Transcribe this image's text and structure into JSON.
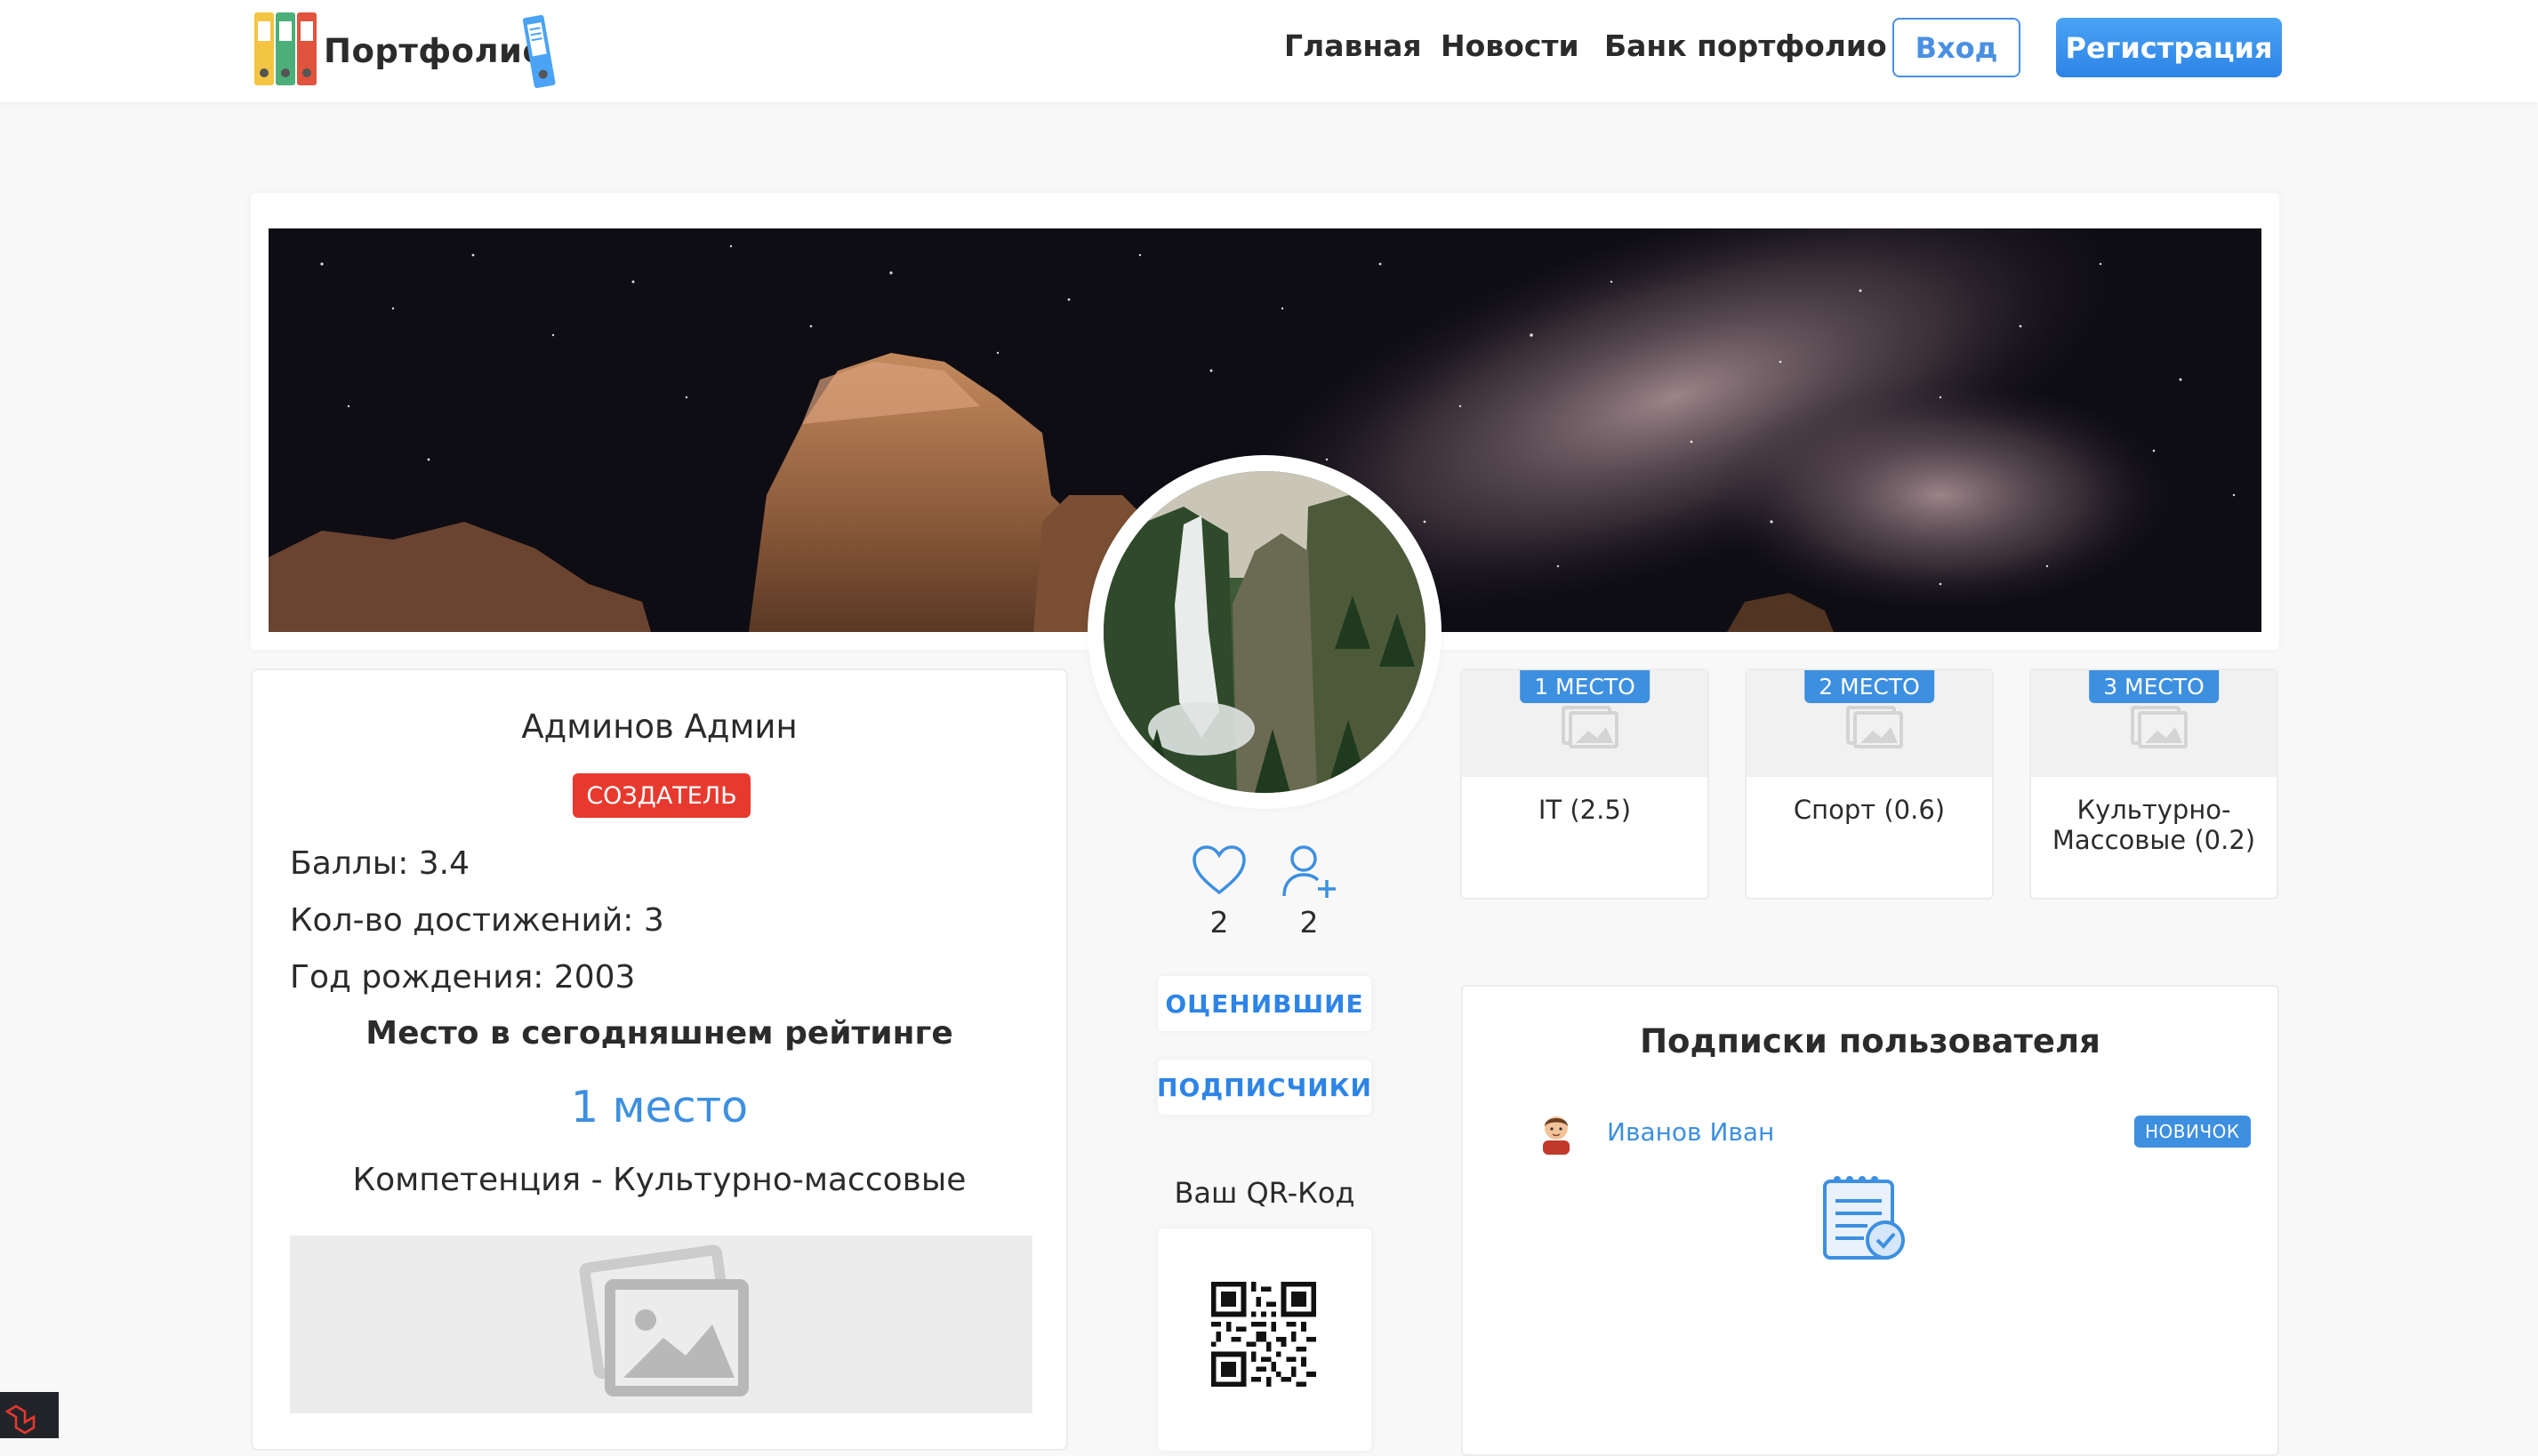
{
  "header": {
    "logo_text": "Портфолио",
    "nav": [
      {
        "label": "Главная"
      },
      {
        "label": "Новости"
      },
      {
        "label": "Банк портфолио"
      }
    ],
    "login_label": "Вход",
    "register_label": "Регистрация"
  },
  "profile": {
    "name": "Админов Админ",
    "role": "СОЗДАТЕЛЬ",
    "points": "Баллы: 3.4",
    "achievements": "Кол-во достижений: 3",
    "birth_year": "Год рождения: 2003",
    "rating_title": "Место в сегодняшнем рейтинге",
    "rating_place": "1 место",
    "competence": "Компетенция - Культурно-массовые"
  },
  "social": {
    "likes_count": "2",
    "followers_count": "2",
    "rated_button": "ОЦЕНИВШИЕ",
    "subscribers_button": "ПОДПИСЧИКИ",
    "qr_label": "Ваш QR-Код"
  },
  "competences": [
    {
      "badge": "1 МЕСТО",
      "label": "IT (2.5)"
    },
    {
      "badge": "2 МЕСТО",
      "label": "Спорт (0.6)"
    },
    {
      "badge": "3 МЕСТО",
      "label": "Культурно-\nМассовые (0.2)"
    }
  ],
  "subscriptions": {
    "title": "Подписки пользователя",
    "items": [
      {
        "name": "Иванов Иван",
        "badge": "НОВИЧОК"
      }
    ]
  },
  "colors": {
    "accent": "#3d8fe0",
    "danger": "#e8392e",
    "background": "#f8f8f8"
  }
}
